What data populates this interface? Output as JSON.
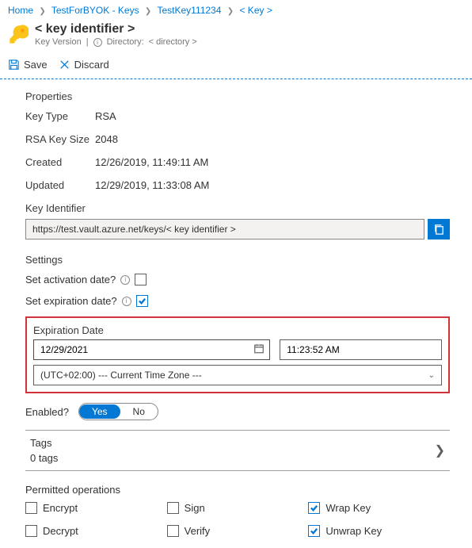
{
  "breadcrumb": [
    "Home",
    "TestForBYOK - Keys",
    "TestKey111234",
    "< Key >"
  ],
  "header": {
    "title": "< key identifier >",
    "version_label": "Key Version",
    "directory_label": "Directory:",
    "directory_value": "< directory >"
  },
  "toolbar": {
    "save": "Save",
    "discard": "Discard"
  },
  "properties": {
    "heading": "Properties",
    "key_type_label": "Key Type",
    "key_type_value": "RSA",
    "rsa_size_label": "RSA Key Size",
    "rsa_size_value": "2048",
    "created_label": "Created",
    "created_value": "12/26/2019, 11:49:11 AM",
    "updated_label": "Updated",
    "updated_value": "12/29/2019, 11:33:08 AM",
    "key_identifier_label": "Key Identifier",
    "key_identifier_value": "https://test.vault.azure.net/keys/< key identifier >"
  },
  "settings": {
    "heading": "Settings",
    "activation_label": "Set activation date?",
    "expiration_label": "Set expiration date?",
    "expiration_checked": true,
    "activation_checked": false,
    "exp_date_heading": "Expiration Date",
    "exp_date_value": "12/29/2021",
    "exp_time_value": "11:23:52 AM",
    "timezone_value": "(UTC+02:00) --- Current Time Zone ---",
    "enabled_label": "Enabled?",
    "enabled_yes": "Yes",
    "enabled_no": "No"
  },
  "tags": {
    "label": "Tags",
    "count_text": "0 tags"
  },
  "perms": {
    "heading": "Permitted operations",
    "items": [
      {
        "label": "Encrypt",
        "checked": false
      },
      {
        "label": "Sign",
        "checked": false
      },
      {
        "label": "Wrap Key",
        "checked": true
      },
      {
        "label": "Decrypt",
        "checked": false
      },
      {
        "label": "Verify",
        "checked": false
      },
      {
        "label": "Unwrap Key",
        "checked": true
      }
    ]
  }
}
